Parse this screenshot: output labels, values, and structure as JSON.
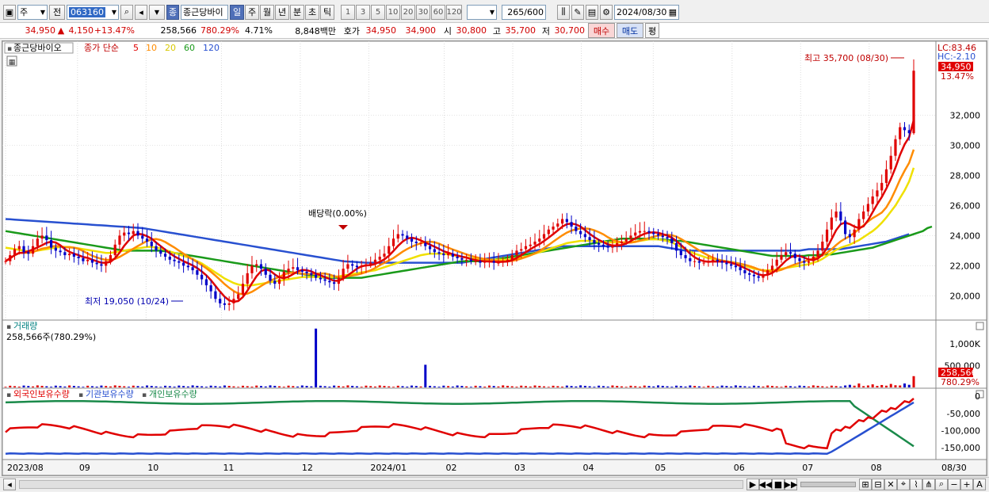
{
  "toolbar": {
    "period_type": "주",
    "prev_label": "전",
    "stock_code": "063160",
    "stock_name": "종근당바이",
    "tag_label": "종",
    "periods": [
      "일",
      "주",
      "월",
      "년",
      "분",
      "초",
      "틱"
    ],
    "selected_period": "일",
    "numbers": [
      "1",
      "3",
      "5",
      "10",
      "20",
      "30",
      "60",
      "120"
    ],
    "count": "265",
    "count_total": "600",
    "date": "2024/08/30"
  },
  "quote": {
    "price": "34,950",
    "change": "4,150",
    "change_pct": "+13.47%",
    "volume": "258,566",
    "volume_pct": "780.29%",
    "turnover_pct": "4.71%",
    "amount": "8,848백만",
    "bid_label": "호가",
    "bid1": "34,950",
    "bid2": "34,900",
    "open_label": "시",
    "open": "30,800",
    "high_label": "고",
    "high": "35,700",
    "low_label": "저",
    "low": "30,700",
    "buy_label": "매수",
    "sell_label": "매도",
    "avg_label": "평"
  },
  "chart_data": [
    {
      "type": "line",
      "title": "종근당바이오",
      "legend": [
        "종가 단순",
        "5",
        "10",
        "20",
        "60",
        "120"
      ],
      "colors": {
        "candle_up": "#e00000",
        "candle_down": "#0000c8",
        "ma5": "#e00000",
        "ma10": "#ff8c00",
        "ma20": "#f0e000",
        "ma60": "#1a9a1a",
        "ma120": "#2850d0"
      },
      "ylim": [
        18600,
        36700
      ],
      "y_ticks": [
        "20,000",
        "22,000",
        "24,000",
        "26,000",
        "28,000",
        "30,000",
        "32,000"
      ],
      "current_price_label": "34,950",
      "current_pct_label": "13.47%",
      "lc_label": "LC:83.46",
      "hc_label": "HC:-2.10",
      "annotations": {
        "high": "최고 35,700 (08/30)",
        "low": "최저 19,050 (10/24)",
        "dividend": "배당락(0.00%)"
      },
      "x_ticks": [
        "2023/08",
        "09",
        "10",
        "11",
        "12",
        "2024/01",
        "02",
        "03",
        "04",
        "05",
        "06",
        "07",
        "08",
        "08/30"
      ],
      "close": [
        22300,
        22700,
        23100,
        23300,
        22900,
        22800,
        23300,
        23800,
        24000,
        23700,
        23200,
        23000,
        22900,
        22700,
        22800,
        22600,
        22500,
        22300,
        22400,
        22200,
        22100,
        22000,
        22300,
        22700,
        23400,
        24000,
        24200,
        24100,
        24300,
        24000,
        23800,
        23600,
        23300,
        23000,
        22800,
        22600,
        22400,
        22300,
        22200,
        22000,
        21900,
        21700,
        21400,
        21100,
        20700,
        20300,
        19800,
        19500,
        19400,
        19500,
        19800,
        20100,
        20800,
        21500,
        22000,
        22100,
        21800,
        21400,
        21000,
        20800,
        21100,
        21600,
        21800,
        21900,
        21700,
        21600,
        21500,
        21400,
        21200,
        21100,
        21000,
        20900,
        20800,
        21200,
        21800,
        22100,
        22000,
        21900,
        22000,
        22100,
        22200,
        22400,
        22600,
        22800,
        23300,
        23800,
        24100,
        24000,
        23800,
        23600,
        23500,
        23500,
        23300,
        23100,
        22900,
        22800,
        22700,
        22800,
        22600,
        22500,
        22400,
        22400,
        22300,
        22300,
        22200,
        22300,
        22300,
        22200,
        22200,
        22300,
        22400,
        22700,
        23000,
        23100,
        23300,
        23400,
        23600,
        23800,
        24100,
        24400,
        24600,
        24800,
        25100,
        24900,
        24600,
        24300,
        24100,
        23900,
        23700,
        23500,
        23400,
        23300,
        23200,
        23300,
        23500,
        23600,
        23800,
        24000,
        24200,
        24300,
        24300,
        24200,
        24100,
        24000,
        23900,
        23800,
        23500,
        23000,
        22700,
        22500,
        22300,
        22300,
        22200,
        22200,
        22300,
        22400,
        22300,
        22200,
        22100,
        22000,
        21900,
        21700,
        21500,
        21400,
        21300,
        21200,
        21400,
        21700,
        22000,
        22400,
        22700,
        22900,
        22800,
        22500,
        22300,
        22200,
        22300,
        22600,
        23000,
        23600,
        24400,
        25200,
        25600,
        25000,
        24100,
        23900,
        24400,
        25100,
        25600,
        26100,
        26600,
        27000,
        27500,
        28400,
        29300,
        30400,
        31200,
        31000,
        30800,
        34950
      ],
      "ma20": [
        23200,
        23150,
        23100,
        23050,
        23000,
        22950,
        22950,
        23000,
        23050,
        23100,
        23150,
        23200,
        23250,
        23250,
        23250,
        23200,
        23150,
        23100,
        23050,
        23000,
        22950,
        22900,
        22850,
        22850,
        22900,
        22950,
        23000,
        23050,
        23100,
        23150,
        23200,
        23250,
        23250,
        23200,
        23150,
        23050,
        22950,
        22850,
        22750,
        22650,
        22550,
        22450,
        22300,
        22150,
        21950,
        21750,
        21550,
        21350,
        21150,
        21000,
        20850,
        20750,
        20700,
        20700,
        20700,
        20750,
        20800,
        20850,
        20900,
        20950,
        21000,
        21050,
        21100,
        21150,
        21200,
        21250,
        21250,
        21250,
        21250,
        21250,
        21250,
        21250,
        21250,
        21300,
        21350,
        21400,
        21450,
        21500,
        21550,
        21600,
        21650,
        21700,
        21800,
        21900,
        22000,
        22100,
        22200,
        22300,
        22400,
        22500,
        22600,
        22700,
        22750,
        22800,
        22800,
        22800,
        22800,
        22750,
        22700,
        22650,
        22600,
        22550,
        22500,
        22450,
        22400,
        22400,
        22400,
        22400,
        22400,
        22400,
        22400,
        22450,
        22500,
        22550,
        22600,
        22700,
        22800,
        22900,
        23000,
        23100,
        23200,
        23300,
        23400,
        23500,
        23550,
        23600,
        23650,
        23650,
        23650,
        23650,
        23600,
        23600,
        23550,
        23550,
        23550,
        23550,
        23550,
        23550,
        23600,
        23650,
        23700,
        23750,
        23750,
        23750,
        23700,
        23650,
        23550,
        23400,
        23250,
        23100,
        22950,
        22800,
        22700,
        22600,
        22500,
        22450,
        22400,
        22350,
        22300,
        22250,
        22200,
        22100,
        22000,
        21900,
        21800,
        21750,
        21700,
        21700,
        21700,
        21750,
        21800,
        21850,
        21900,
        21950,
        22000,
        22050,
        22100,
        22200,
        22300,
        22450,
        22650,
        22850,
        23050,
        23200,
        23300,
        23400,
        23550,
        23700,
        23900,
        24100,
        24300,
        24550,
        24850,
        25200,
        25600,
        26000,
        26500,
        27000,
        27600,
        28500
      ],
      "ma60": [
        24300,
        24250,
        24200,
        24150,
        24100,
        24050,
        24000,
        23950,
        23900,
        23850,
        23800,
        23750,
        23700,
        23650,
        23600,
        23550,
        23500,
        23450,
        23400,
        23350,
        23300,
        23250,
        23200,
        23150,
        23100,
        23050,
        23000,
        23000,
        23000,
        23000,
        23000,
        23000,
        23000,
        23000,
        23000,
        22950,
        22900,
        22850,
        22800,
        22750,
        22700,
        22650,
        22600,
        22550,
        22500,
        22450,
        22400,
        22350,
        22300,
        22250,
        22200,
        22150,
        22100,
        22050,
        22000,
        21950,
        21900,
        21850,
        21800,
        21750,
        21700,
        21650,
        21600,
        21550,
        21500,
        21450,
        21400,
        21350,
        21300,
        21250,
        21200,
        21200,
        21200,
        21200,
        21200,
        21200,
        21200,
        21200,
        21200,
        21250,
        21300,
        21350,
        21400,
        21450,
        21500,
        21550,
        21600,
        21650,
        21700,
        21750,
        21800,
        21850,
        21900,
        21950,
        22000,
        22050,
        22100,
        22150,
        22200,
        22250,
        22300,
        22300,
        22300,
        22300,
        22300,
        22300,
        22350,
        22400,
        22450,
        22500,
        22550,
        22600,
        22650,
        22700,
        22750,
        22800,
        22850,
        22900,
        22950,
        23000,
        23050,
        23100,
        23150,
        23200,
        23250,
        23300,
        23350,
        23400,
        23450,
        23500,
        23550,
        23600,
        23650,
        23700,
        23750,
        23800,
        23800,
        23800,
        23800,
        23800,
        23800,
        23800,
        23800,
        23750,
        23750,
        23700,
        23700,
        23650,
        23650,
        23600,
        23550,
        23500,
        23450,
        23400,
        23350,
        23300,
        23250,
        23200,
        23150,
        23100,
        23050,
        23000,
        22950,
        22900,
        22850,
        22800,
        22750,
        22700,
        22650,
        22650,
        22650,
        22650,
        22650,
        22650,
        22650,
        22650,
        22700,
        22700,
        22700,
        22750,
        22750,
        22750,
        22800,
        22850,
        22900,
        22950,
        23000,
        23050,
        23100,
        23150,
        23200,
        23300,
        23400,
        23500,
        23600,
        23700,
        23800,
        23900,
        24000,
        24100,
        24200,
        24300,
        24500,
        24600
      ],
      "ma120": [
        25100,
        25080,
        25060,
        25040,
        25020,
        25000,
        24980,
        24960,
        24940,
        24920,
        24900,
        24880,
        24860,
        24840,
        24820,
        24800,
        24780,
        24760,
        24740,
        24720,
        24700,
        24680,
        24660,
        24640,
        24620,
        24600,
        24580,
        24560,
        24540,
        24520,
        24500,
        24450,
        24400,
        24350,
        24300,
        24250,
        24200,
        24150,
        24100,
        24050,
        24000,
        23950,
        23900,
        23850,
        23800,
        23750,
        23700,
        23650,
        23600,
        23550,
        23500,
        23450,
        23400,
        23350,
        23300,
        23250,
        23200,
        23150,
        23100,
        23050,
        23000,
        22950,
        22900,
        22850,
        22800,
        22750,
        22700,
        22650,
        22600,
        22550,
        22500,
        22450,
        22400,
        22350,
        22300,
        22280,
        22260,
        22240,
        22220,
        22200,
        22200,
        22200,
        22200,
        22200,
        22200,
        22200,
        22200,
        22200,
        22200,
        22200,
        22200,
        22200,
        22200,
        22200,
        22200,
        22200,
        22200,
        22200,
        22200,
        22200,
        22200,
        22250,
        22300,
        22350,
        22400,
        22450,
        22500,
        22550,
        22600,
        22650,
        22700,
        22750,
        22800,
        22850,
        22900,
        22950,
        23000,
        23050,
        23100,
        23150,
        23200,
        23250,
        23300,
        23300,
        23300,
        23300,
        23300,
        23300,
        23300,
        23300,
        23300,
        23300,
        23300,
        23300,
        23300,
        23300,
        23300,
        23300,
        23300,
        23300,
        23300,
        23300,
        23300,
        23300,
        23250,
        23200,
        23150,
        23100,
        23050,
        23000,
        23000,
        23000,
        23000,
        23000,
        23000,
        23000,
        23000,
        23000,
        23000,
        23000,
        23000,
        23000,
        23000,
        23000,
        23000,
        23000,
        23000,
        23000,
        23000,
        23000,
        23000,
        23000,
        23000,
        23000,
        23000,
        23050,
        23100,
        23100,
        23100,
        23100,
        23100,
        23100,
        23100,
        23100,
        23150,
        23200,
        23250,
        23300,
        23350,
        23400,
        23450,
        23500,
        23550,
        23600,
        23700,
        23800,
        23900,
        24000,
        24100
      ]
    },
    {
      "type": "bar",
      "title": "거래량",
      "label": "258,566주(780.29%)",
      "y_ticks": [
        "1,000K",
        "500,000"
      ],
      "ylim": [
        0,
        1400000
      ],
      "last_label": "258,566",
      "last_pct": "780.29%",
      "spikes": [
        {
          "i": 68,
          "v": 1350000
        },
        {
          "i": 92,
          "v": 520000
        }
      ],
      "base_volume": 35000,
      "recent_volumes": [
        60000,
        40000,
        90000,
        30000,
        45000,
        70000,
        35000,
        55000,
        40000,
        80000,
        50000,
        45000,
        90000,
        60000,
        258566
      ]
    },
    {
      "type": "line",
      "legend": [
        "외국인보유수량",
        "기관보유수량",
        "개인보유수량"
      ],
      "colors": {
        "foreign": "#e00000",
        "institution": "#2850d0",
        "individual": "#1a8a4a"
      },
      "y_ticks": [
        "0",
        "-50,000",
        "-100,000",
        "-150,000"
      ],
      "ylim": [
        -180000,
        5000
      ]
    }
  ],
  "bottom": {
    "buttons": [
      "▶",
      "◀◀",
      "■",
      "▶▶"
    ]
  }
}
